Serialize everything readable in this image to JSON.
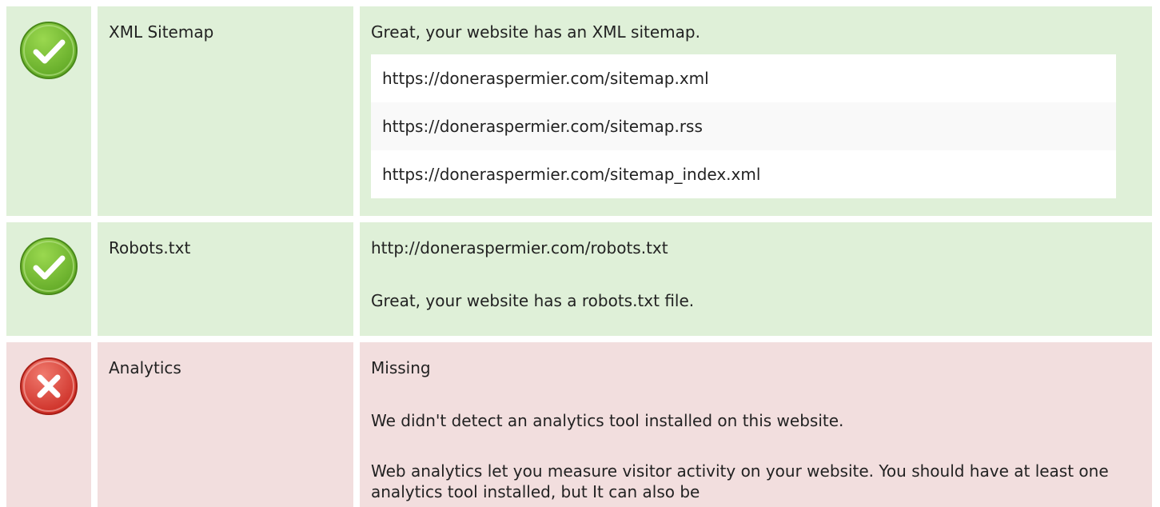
{
  "colors": {
    "pass_bg": "#dff0d8",
    "fail_bg": "#f2dede",
    "pass_icon": "#6cb52c",
    "fail_icon": "#d9332b"
  },
  "rows": [
    {
      "status": "pass",
      "icon": "check-circle-icon",
      "label": "XML Sitemap",
      "message": "Great, your website has an XML sitemap.",
      "urls": [
        "https://doneraspermier.com/sitemap.xml",
        "https://doneraspermier.com/sitemap.rss",
        "https://doneraspermier.com/sitemap_index.xml"
      ]
    },
    {
      "status": "pass",
      "icon": "check-circle-icon",
      "label": "Robots.txt",
      "url": "http://doneraspermier.com/robots.txt",
      "message": "Great, your website has a robots.txt file."
    },
    {
      "status": "fail",
      "icon": "x-circle-icon",
      "label": "Analytics",
      "status_text": "Missing",
      "message": "We didn't detect an analytics tool installed on this website.",
      "description": "Web analytics let you measure visitor activity on your website. You should have at least one analytics tool installed, but It can also be"
    }
  ]
}
